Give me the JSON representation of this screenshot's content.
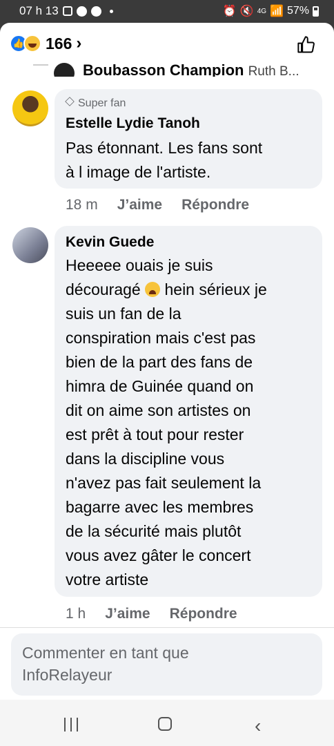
{
  "status_bar": {
    "time": "07 h 13",
    "network": "4G",
    "battery": "57%"
  },
  "header": {
    "reaction_count": "166",
    "chevron": "›"
  },
  "previous_comment": {
    "author": "Boubasson Champion",
    "snippet": "Ruth B..."
  },
  "comments": [
    {
      "badge": "Super fan",
      "author": "Estelle Lydie Tanoh",
      "text": "Pas étonnant. Les fans sont\nà l image de l'artiste.",
      "time": "18 m",
      "like_label": "J’aime",
      "reply_label": "Répondre"
    },
    {
      "author": "Kevin Guede",
      "text_before_emoji": "Heeeee ouais je suis\ndécouragé ",
      "emoji": "crying-face",
      "text_after_emoji": " hein sérieux je\nsuis un fan de la\nconspiration mais c'est pas\nbien de la part des fans de\nhimra de Guinée quand on\ndit on aime son artistes on\nest prêt à tout pour rester\ndans la discipline vous\nn'avez pas fait seulement la\nbagarre avec les membres\nde la sécurité mais plutôt\nvous avez gâter le concert\nvotre artiste",
      "time": "1 h",
      "like_label": "J’aime",
      "reply_label": "Répondre"
    }
  ],
  "composer": {
    "placeholder": "Commenter en tant que\nInfoRelayeur"
  },
  "colors": {
    "accent": "#1877f2",
    "bubble": "#f0f2f5",
    "meta_text": "#65676b"
  }
}
